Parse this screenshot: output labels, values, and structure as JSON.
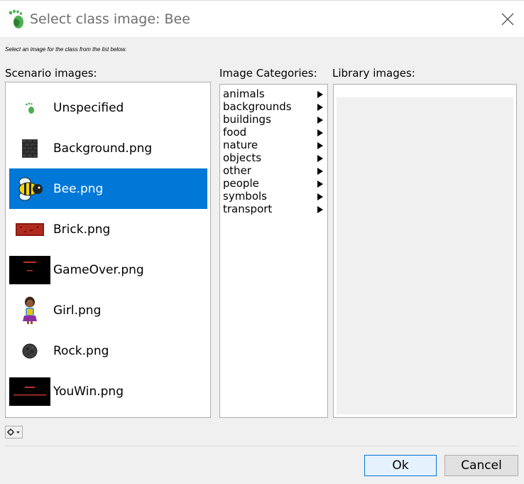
{
  "window": {
    "title": "Select class image: Bee",
    "title_icon": "greenfoot-footprint-icon",
    "close_icon": "close-icon"
  },
  "instruction": "Select an image for the class from the list below.",
  "scenario": {
    "label": "Scenario images:",
    "items": [
      {
        "label": "Unspecified",
        "icon": "greenfoot-footprint-icon",
        "selected": false
      },
      {
        "label": "Background.png",
        "icon": "brick-wall-icon",
        "selected": false
      },
      {
        "label": "Bee.png",
        "icon": "bee-icon",
        "selected": true
      },
      {
        "label": "Brick.png",
        "icon": "red-brick-icon",
        "selected": false
      },
      {
        "label": "GameOver.png",
        "icon": "game-over-thumbnail",
        "selected": false
      },
      {
        "label": "Girl.png",
        "icon": "girl-icon",
        "selected": false
      },
      {
        "label": "Rock.png",
        "icon": "rock-icon",
        "selected": false
      },
      {
        "label": "YouWin.png",
        "icon": "you-win-thumbnail",
        "selected": false
      }
    ]
  },
  "categories": {
    "label": "Image Categories:",
    "items": [
      "animals",
      "backgrounds",
      "buildings",
      "food",
      "nature",
      "objects",
      "other",
      "people",
      "symbols",
      "transport"
    ]
  },
  "library": {
    "label": "Library images:"
  },
  "buttons": {
    "ok": "Ok",
    "cancel": "Cancel",
    "gear_icon": "gear-icon"
  },
  "colors": {
    "selection": "#0078d7",
    "ok_border": "#0078d7",
    "footprint_green": "#4caf50"
  }
}
